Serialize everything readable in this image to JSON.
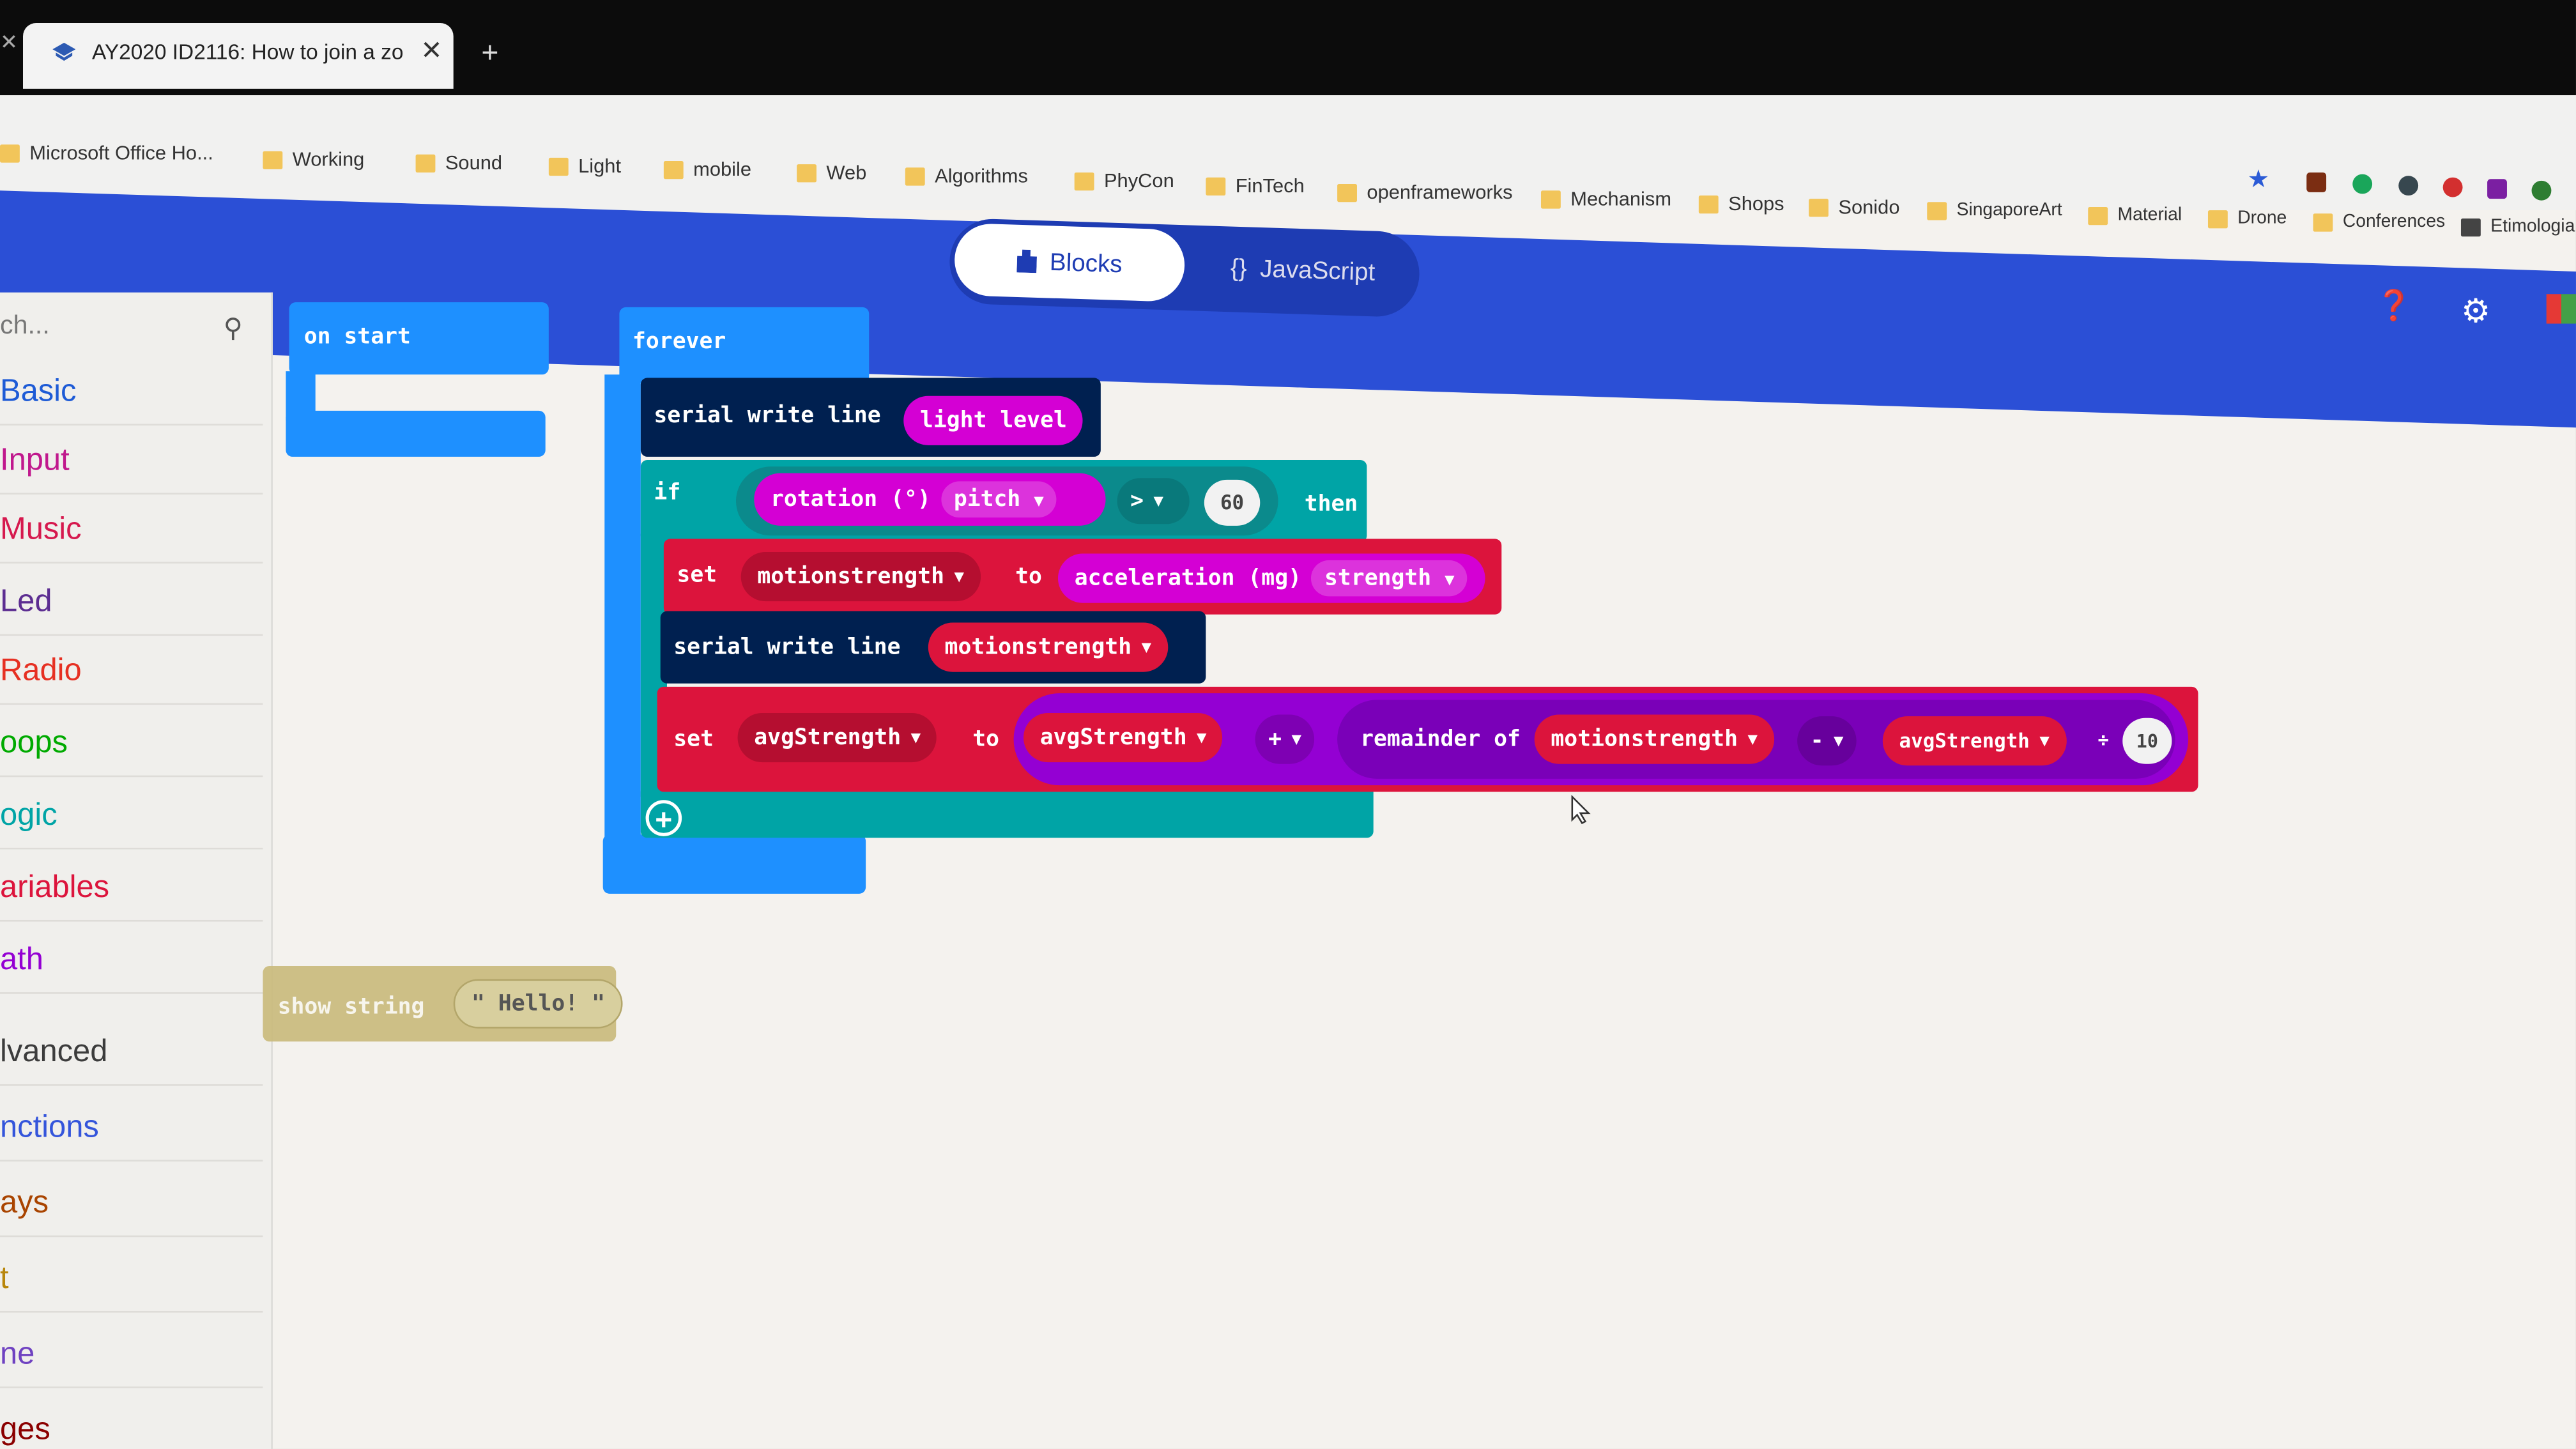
{
  "browser": {
    "tab_title": "AY2020 ID2116: How to join a zo",
    "new_tab": "+",
    "close": "✕"
  },
  "bookmarks": [
    "Microsoft Office Ho...",
    "Working",
    "Sound",
    "Light",
    "mobile",
    "Web",
    "Algorithms",
    "PhyCon",
    "FinTech",
    "openframeworks",
    "Mechanism",
    "Shops",
    "Sonido",
    "SingaporeArt",
    "Material",
    "Drone",
    "Conferences",
    "Etimologia"
  ],
  "header": {
    "blocks_label": "Blocks",
    "javascript_label": "JavaScript",
    "js_icon": "{}",
    "colors": {
      "bar": "#2b4fd6",
      "toggle": "#1e3cb3"
    }
  },
  "sidebar": {
    "search_placeholder": "ch...",
    "categories": [
      {
        "label": "Basic",
        "color": "#1e5bd6"
      },
      {
        "label": "Input",
        "color": "#c0188d"
      },
      {
        "label": "Music",
        "color": "#d6194e"
      },
      {
        "label": "Led",
        "color": "#5c2d91"
      },
      {
        "label": "Radio",
        "color": "#e63022"
      },
      {
        "label": "oops",
        "color": "#00aa00"
      },
      {
        "label": "ogic",
        "color": "#00a4a6"
      },
      {
        "label": "ariables",
        "color": "#dc143c"
      },
      {
        "label": "ath",
        "color": "#9400d3"
      },
      {
        "label": "lvanced",
        "color": "#3c3c3c"
      },
      {
        "label": "nctions",
        "color": "#3455db"
      },
      {
        "label": "ays",
        "color": "#a94400"
      },
      {
        "label": "t",
        "color": "#b8860b"
      },
      {
        "label": "ne",
        "color": "#6f42c1"
      },
      {
        "label": "ges",
        "color": "#8b0000"
      }
    ]
  },
  "workspace": {
    "on_start": "on start",
    "forever": "forever",
    "serial_write_line": "serial write line",
    "light_level": "light level",
    "if": "if",
    "then": "then",
    "rotation": "rotation (°)",
    "pitch": "pitch",
    "gt": ">",
    "sixty": "60",
    "set": "set",
    "to": "to",
    "motionstrength": "motionstrength",
    "acceleration": "acceleration (mg)",
    "strength": "strength",
    "avgStrength": "avgStrength",
    "plus": "+",
    "remainder_of": "remainder of",
    "minus": "-",
    "divide": "÷",
    "ten": "10",
    "show_string": "show string",
    "hello": "\" Hello! \"",
    "colors": {
      "basic": "#1e90ff",
      "input": "#d400d4",
      "serial": "#002050",
      "logic": "#00a4a6",
      "variables": "#dc143c",
      "math": "#9400d3"
    }
  }
}
